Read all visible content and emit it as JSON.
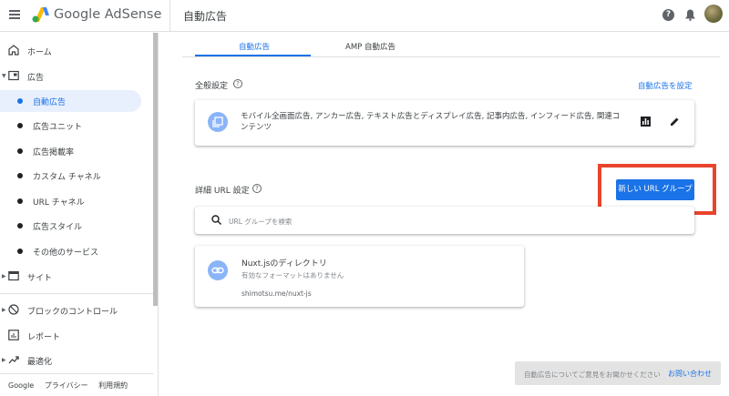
{
  "header": {
    "brand": "Google AdSense",
    "page_title": "自動広告"
  },
  "sidebar": {
    "items": [
      {
        "label": "ホーム"
      },
      {
        "label": "広告"
      },
      {
        "label": "自動広告"
      },
      {
        "label": "広告ユニット"
      },
      {
        "label": "広告掲載率"
      },
      {
        "label": "カスタム チャネル"
      },
      {
        "label": "URL チャネル"
      },
      {
        "label": "広告スタイル"
      },
      {
        "label": "その他のサービス"
      },
      {
        "label": "サイト"
      },
      {
        "label": "ブロックのコントロール"
      },
      {
        "label": "レポート"
      },
      {
        "label": "最適化"
      }
    ],
    "footer": {
      "google": "Google",
      "privacy": "プライバシー",
      "terms": "利用規約"
    }
  },
  "tabs": [
    {
      "label": "自動広告"
    },
    {
      "label": "AMP 自動広告"
    }
  ],
  "general": {
    "title": "全般設定",
    "settings_link": "自動広告を設定",
    "formats": "モバイル全画面広告, アンカー広告, テキスト広告とディスプレイ広告, 記事内広告, インフィード広告, 関連コ",
    "formats_line2": "ンテンツ"
  },
  "advanced": {
    "title": "詳細 URL 設定",
    "new_group_button": "新しい URL グループ",
    "search_placeholder": "URL グループを検索",
    "group": {
      "name": "Nuxt.jsのディレクトリ",
      "status": "有効なフォーマットはありません",
      "url": "shimotsu.me/nuxt-js"
    }
  },
  "feedback": {
    "message": "自動広告についてご意見をお聞かせください",
    "link": "お問い合わせ"
  },
  "colors": {
    "accent": "#1a73e8",
    "highlight": "#e8442c"
  }
}
